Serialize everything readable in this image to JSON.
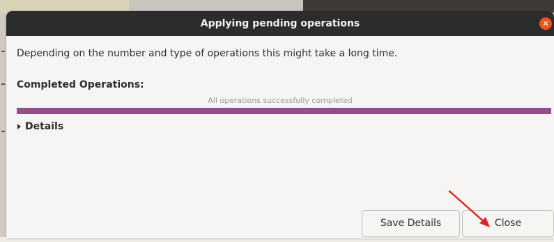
{
  "window": {
    "title": "Applying pending operations",
    "close_icon": "close-icon"
  },
  "main": {
    "description": "Depending on the number and type of operations this might take a long time.",
    "completed_label": "Completed Operations:",
    "progress_text": "All operations successfully completed",
    "progress_fraction": 1.0,
    "details_label": "Details",
    "details_icon": "disclosure-triangle-icon"
  },
  "buttons": {
    "save_details": "Save Details",
    "close": "Close"
  },
  "colors": {
    "titlebar": "#2c2c2c",
    "close_accent": "#e95420",
    "progress": "#924d8b",
    "annotation_arrow": "#e02424"
  }
}
